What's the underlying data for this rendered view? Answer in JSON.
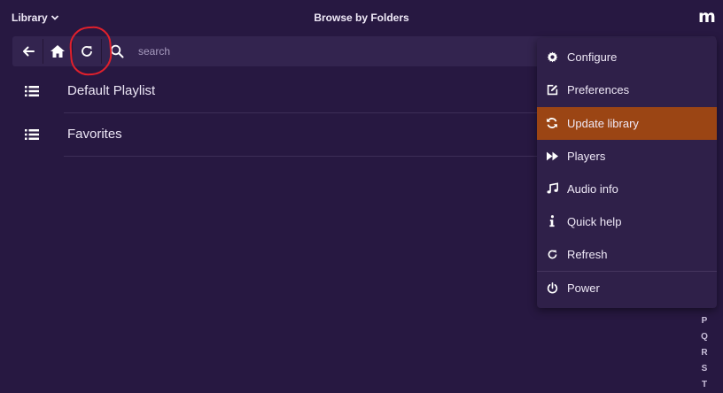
{
  "header": {
    "library_label": "Library",
    "title": "Browse by Folders",
    "logo": "m"
  },
  "toolbar": {
    "back_icon": "arrow-left-icon",
    "home_icon": "home-icon",
    "refresh_icon": "refresh-icon",
    "search_icon": "search-icon",
    "search_placeholder": "search",
    "search_value": ""
  },
  "list": {
    "items": [
      {
        "label": "Default Playlist",
        "icon": "list-icon"
      },
      {
        "label": "Favorites",
        "icon": "list-icon"
      }
    ]
  },
  "menu": {
    "items": [
      {
        "label": "Configure",
        "icon": "gear-icon",
        "active": false
      },
      {
        "label": "Preferences",
        "icon": "edit-icon",
        "active": false
      },
      {
        "label": "Update library",
        "icon": "sync-icon",
        "active": true
      },
      {
        "label": "Players",
        "icon": "fast-forward-icon",
        "active": false
      },
      {
        "label": "Audio info",
        "icon": "music-note-icon",
        "active": false
      },
      {
        "label": "Quick help",
        "icon": "info-icon",
        "active": false
      },
      {
        "label": "Refresh",
        "icon": "refresh-icon",
        "active": false
      },
      {
        "label": "Power",
        "icon": "power-icon",
        "active": false
      }
    ]
  },
  "alphabet": [
    "P",
    "Q",
    "R",
    "S",
    "T"
  ],
  "colors": {
    "background": "#271841",
    "toolbar": "#33244f",
    "menu": "#2f2049",
    "active_item": "#9b4514",
    "highlight_ring": "#e0202c"
  }
}
